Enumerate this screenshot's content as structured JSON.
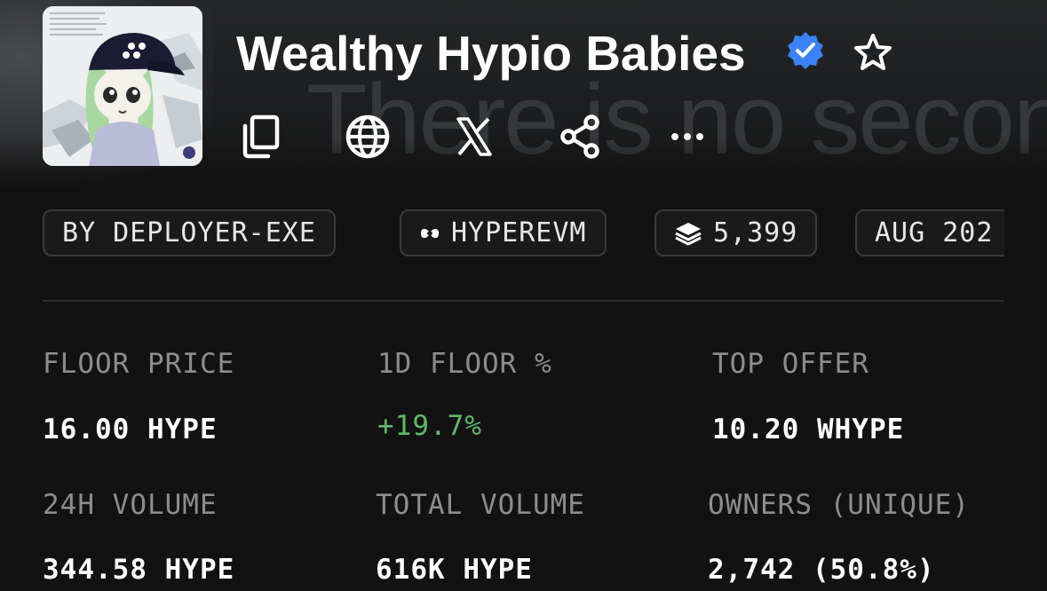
{
  "banner": {
    "text": "There is no secon"
  },
  "collection": {
    "name": "Wealthy Hypio Babies",
    "verified": true,
    "verified_icon": "verified-badge-icon",
    "accent_color": "#3b82f6"
  },
  "actions": [
    {
      "name": "copy",
      "icon": "copy-icon"
    },
    {
      "name": "website",
      "icon": "globe-icon"
    },
    {
      "name": "x",
      "icon": "x-logo-icon"
    },
    {
      "name": "share",
      "icon": "share-icon"
    },
    {
      "name": "more",
      "icon": "more-icon"
    }
  ],
  "chips": {
    "creator": "BY DEPLOYER-EXE",
    "chain": "HYPEREVM",
    "items": "5,399",
    "date": "AUG 202"
  },
  "stats": {
    "floor_price": {
      "label": "FLOOR PRICE",
      "value": "16.00 HYPE"
    },
    "floor_change": {
      "label": "1D FLOOR %",
      "value": "+19.7%",
      "color": "#5fb96a"
    },
    "top_offer": {
      "label": "TOP OFFER",
      "value": "10.20 WHYPE"
    },
    "volume_24h": {
      "label": "24H VOLUME",
      "value": "344.58 HYPE"
    },
    "total_volume": {
      "label": "TOTAL VOLUME",
      "value": "616K HYPE"
    },
    "owners": {
      "label": "OWNERS (UNIQUE)",
      "value": "2,742 (50.8%)"
    }
  }
}
